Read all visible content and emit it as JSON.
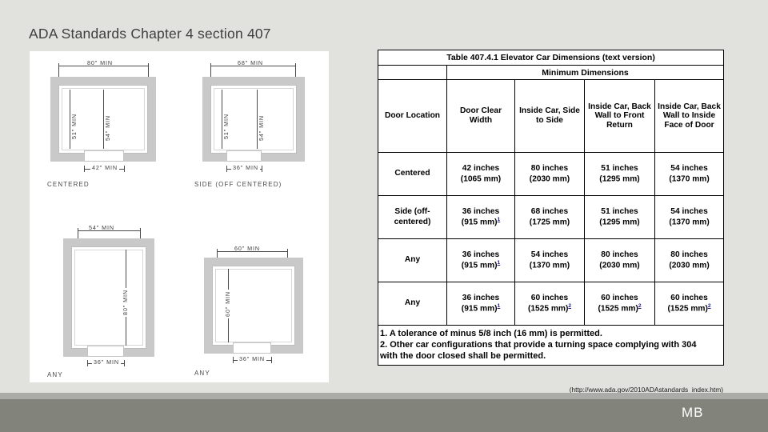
{
  "slide": {
    "title": "ADA Standards Chapter 4 section 407",
    "footer_initials": "MB",
    "source_url": "(http://www.ada.gov/2010ADAstandards_index.htm)"
  },
  "diagrams": [
    {
      "caption": "CENTERED",
      "width_label": "80\" MIN",
      "left_depth_label": "51\" MIN",
      "right_depth_label": "54\" MIN",
      "door_label": "42\" MIN"
    },
    {
      "caption": "SIDE (OFF CENTERED)",
      "width_label": "68\" MIN",
      "left_depth_label": "51\" MIN",
      "right_depth_label": "54\" MIN",
      "door_label": "36\" MIN"
    },
    {
      "caption": "ANY",
      "width_label": "54\" MIN",
      "depth_label": "80\" MIN",
      "door_label": "36\" MIN"
    },
    {
      "caption": "ANY",
      "width_label": "60\" MIN",
      "depth_label": "60\" MIN",
      "door_label": "36\" MIN"
    }
  ],
  "table": {
    "title": "Table 407.4.1 Elevator Car Dimensions (text version)",
    "group_header": "Minimum Dimensions",
    "headers": [
      "Door Location",
      "Door Clear Width",
      "Inside Car, Side to Side",
      "Inside Car, Back Wall to Front Return",
      "Inside Car, Back Wall to Inside Face of Door"
    ],
    "rows": [
      {
        "location": "Centered",
        "cells": [
          {
            "inch": "42 inches",
            "mm": "(1065 mm)",
            "fn": ""
          },
          {
            "inch": "80 inches",
            "mm": "(2030 mm)",
            "fn": ""
          },
          {
            "inch": "51 inches",
            "mm": "(1295 mm)",
            "fn": ""
          },
          {
            "inch": "54 inches",
            "mm": "(1370 mm)",
            "fn": ""
          }
        ]
      },
      {
        "location": "Side (off-centered)",
        "cells": [
          {
            "inch": "36 inches",
            "mm": "(915 mm)",
            "fn": "1"
          },
          {
            "inch": "68 inches",
            "mm": "(1725 mm)",
            "fn": ""
          },
          {
            "inch": "51 inches",
            "mm": "(1295 mm)",
            "fn": ""
          },
          {
            "inch": "54 inches",
            "mm": "(1370 mm)",
            "fn": ""
          }
        ]
      },
      {
        "location": "Any",
        "cells": [
          {
            "inch": "36 inches",
            "mm": "(915 mm)",
            "fn": "1"
          },
          {
            "inch": "54 inches",
            "mm": "(1370 mm)",
            "fn": ""
          },
          {
            "inch": "80 inches",
            "mm": "(2030 mm)",
            "fn": ""
          },
          {
            "inch": "80 inches",
            "mm": "(2030 mm)",
            "fn": ""
          }
        ]
      },
      {
        "location": "Any",
        "cells": [
          {
            "inch": "36 inches",
            "mm": "(915 mm)",
            "fn": "1"
          },
          {
            "inch": "60 inches",
            "mm": "(1525 mm)",
            "fn": "2"
          },
          {
            "inch": "60 inches",
            "mm": "(1525 mm)",
            "fn": "2"
          },
          {
            "inch": "60 inches",
            "mm": "(1525 mm)",
            "fn": "2"
          }
        ]
      }
    ],
    "notes": [
      "1. A tolerance of minus 5/8 inch (16 mm) is permitted.",
      "2. Other car configurations that provide a turning space complying with 304",
      "with the door closed shall be permitted."
    ]
  }
}
